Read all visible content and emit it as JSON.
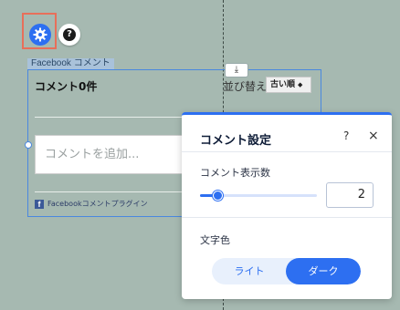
{
  "toolbar": {
    "settings_icon": "gear-icon",
    "help_icon": "help-icon",
    "help_glyph": "?"
  },
  "widget": {
    "tag_label": "Facebook コメント",
    "download_glyph": "⤓",
    "comment_count": "コメント0件",
    "sort_label": "並び替え",
    "sort_value": "古い順",
    "input_placeholder": "コメントを追加...",
    "plugin_text": "Facebookコメントプラグイン",
    "plugin_logo": "f"
  },
  "settings_panel": {
    "title": "コメント設定",
    "help_glyph": "?",
    "close_glyph": "×",
    "count_label": "コメント表示数",
    "count_value": "2",
    "slider_level": 0.15,
    "text_color_label": "文字色",
    "options": [
      "ライト",
      "ダーク"
    ],
    "selected_option": "ダーク"
  },
  "colors": {
    "accent": "#2d6ff1",
    "highlight_border": "#e86f5a",
    "canvas": "#a6b9b1"
  }
}
